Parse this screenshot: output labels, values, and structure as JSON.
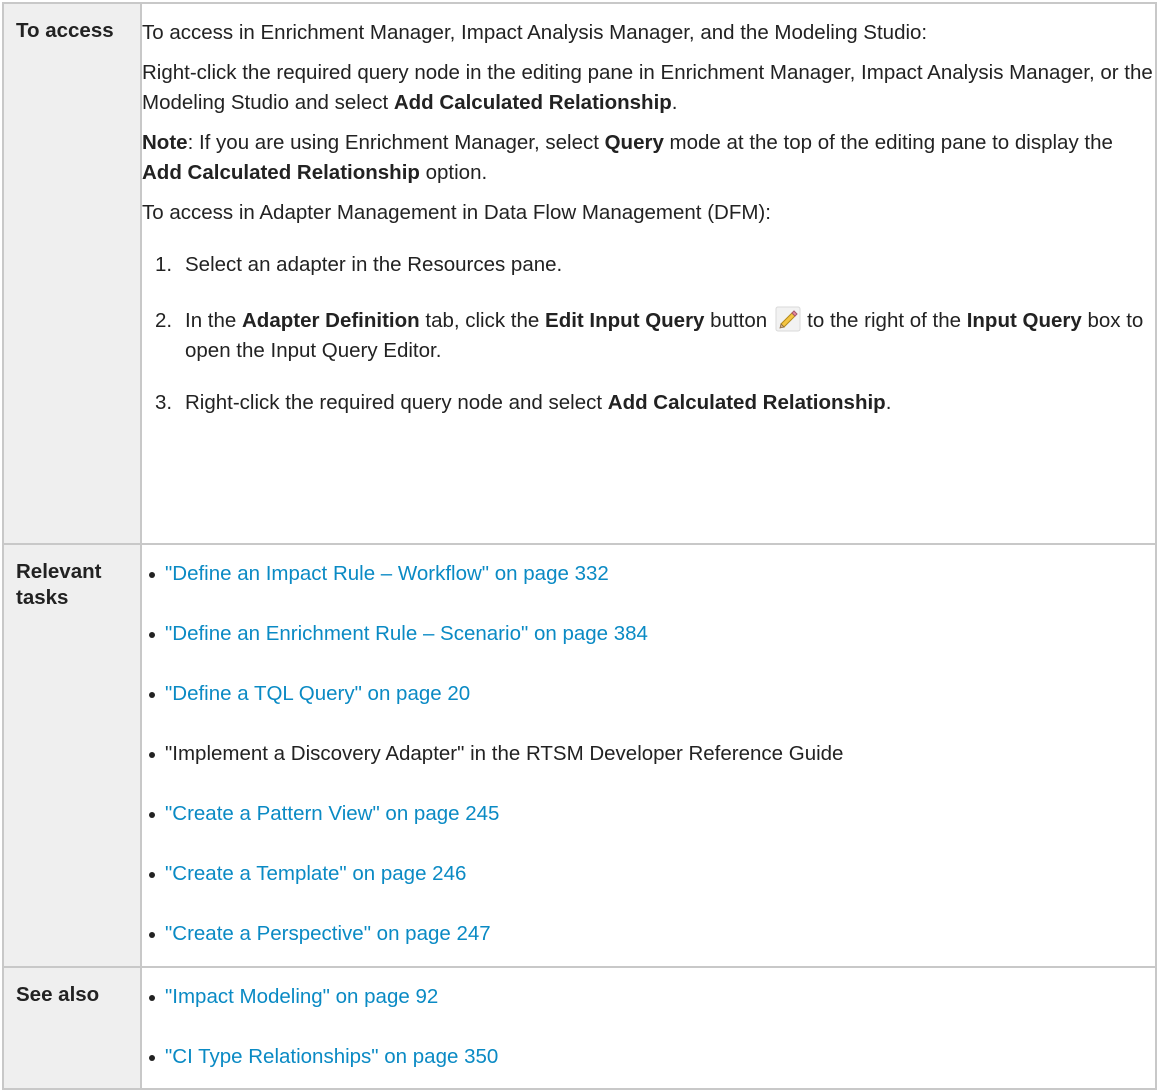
{
  "to_access": {
    "label": "To access",
    "intro": "To access in Enrichment Manager, Impact Analysis Manager, and the Modeling Studio:",
    "right_click": {
      "text": "Right-click the required query node in the editing pane in Enrichment Manager, Impact Analysis Manager, or the Modeling Studio and select ",
      "bold": "Add Calculated Relationship",
      "end": "."
    },
    "note": {
      "label": "Note",
      "text1": ": If you are using Enrichment Manager, select ",
      "bold1": "Query",
      "text2": " mode at the top of the editing pane to display the ",
      "bold2": "Add Calculated Relationship",
      "text3": " option."
    },
    "dfm_intro": "To access in Adapter Management in Data Flow Management (DFM):",
    "steps": {
      "s1": {
        "num": "1.",
        "text": "Select an adapter in the Resources pane."
      },
      "s2": {
        "num": "2.",
        "t1": "In the ",
        "b1": "Adapter Definition",
        "t2": " tab, click the ",
        "b2": "Edit Input Query",
        "t3": " button",
        "t4": "to the right of the ",
        "b3": "Input Query",
        "t5": " box to open the Input Query Editor."
      },
      "s3": {
        "num": "3.",
        "t1": "Right-click the required query node and select ",
        "b1": "Add Calculated Relationship",
        "t2": "."
      }
    },
    "icon": "pencil-icon"
  },
  "relevant_tasks": {
    "label": "Relevant tasks",
    "items": [
      {
        "text": "\"Define an Impact Rule – Workflow\" on page 332",
        "link": true
      },
      {
        "text": "\"Define an Enrichment Rule – Scenario\" on page 384",
        "link": true
      },
      {
        "text": "\"Define a TQL Query\" on page 20",
        "link": true
      },
      {
        "text": "\"Implement a Discovery Adapter\" in the RTSM Developer Reference Guide",
        "link": false
      },
      {
        "text": "\"Create a Pattern View\" on page 245",
        "link": true
      },
      {
        "text": "\"Create a Template\" on page 246",
        "link": true
      },
      {
        "text": "\"Create a Perspective\" on page 247",
        "link": true
      }
    ]
  },
  "see_also": {
    "label": "See also",
    "items": [
      {
        "text": "\"Impact Modeling\" on page 92",
        "link": true
      },
      {
        "text": "\"CI Type Relationships\" on page 350",
        "link": true
      }
    ]
  },
  "colors": {
    "link": "#0a8ac4",
    "header_bg": "#efefef",
    "border": "#c8c8c8",
    "text": "#222222"
  }
}
